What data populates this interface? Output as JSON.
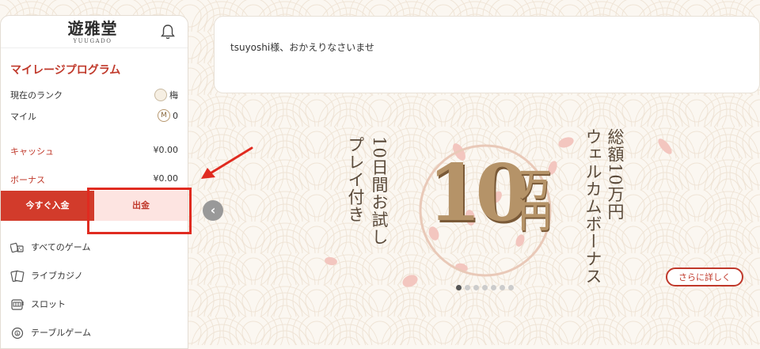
{
  "sidebar": {
    "logo_main": "遊雅堂",
    "logo_sub": "YUUGADO",
    "mileage_title": "マイレージプログラム",
    "rank_label": "現在のランク",
    "rank_value": "梅",
    "mile_label": "マイル",
    "mile_icon": "M",
    "mile_value": "0",
    "cash_label": "キャッシュ",
    "cash_value": "¥0.00",
    "bonus_label": "ボーナス",
    "bonus_value": "¥0.00",
    "deposit_label": "今すぐ入金",
    "withdraw_label": "出金",
    "nav": [
      {
        "label": "すべてのゲーム",
        "icon": "cards-dice-icon"
      },
      {
        "label": "ライブカジノ",
        "icon": "playing-cards-icon"
      },
      {
        "label": "スロット",
        "icon": "slot-machine-icon"
      },
      {
        "label": "テーブルゲーム",
        "icon": "roulette-icon"
      }
    ]
  },
  "greeting": "tsuyoshi様、おかえりなさいませ",
  "banner": {
    "text_col1": "総額10万円",
    "text_col2": "ウェルカムボーナス",
    "text_col3": "10日間お試し",
    "text_col4": "プレイ付き",
    "big_number": "10",
    "big_unit": "万円",
    "more_button": "さらに詳しく",
    "active_slide": 1,
    "slide_count": 7
  },
  "colors": {
    "accent": "#c0392b",
    "deposit_bg": "#d23b2b",
    "withdraw_bg": "#fde4e1",
    "highlight": "#e02b20"
  }
}
